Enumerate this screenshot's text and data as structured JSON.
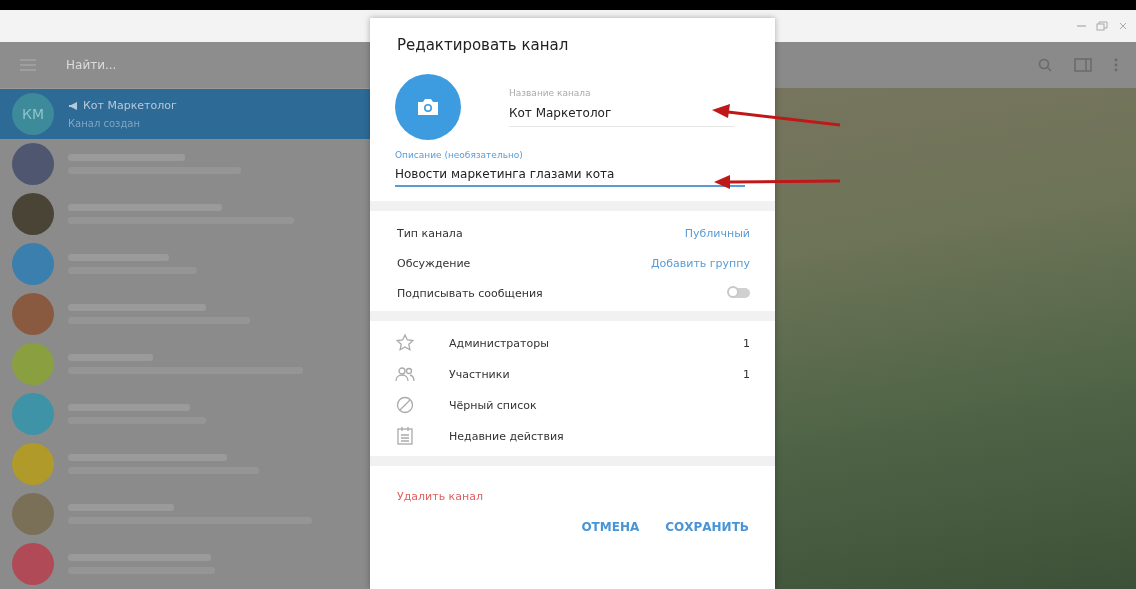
{
  "sidebar": {
    "search": {
      "placeholder": "Найти..."
    },
    "chats": [
      {
        "initials": "КМ",
        "name": "Кот Маркетолог",
        "status": "Канал создан",
        "selected": true,
        "color": "#3d8a9a"
      },
      {
        "selected": false,
        "color": "#4e5670"
      },
      {
        "selected": false,
        "color": "#4a4436"
      },
      {
        "selected": false,
        "color": "#3a7fae"
      },
      {
        "selected": false,
        "color": "#8a5a40"
      },
      {
        "selected": false,
        "color": "#8aa040"
      },
      {
        "selected": false,
        "color": "#3f93a6"
      },
      {
        "selected": false,
        "color": "#b09a2a"
      },
      {
        "selected": false,
        "color": "#7a7058"
      },
      {
        "selected": false,
        "color": "#b04a56"
      }
    ]
  },
  "dialog": {
    "title": "Редактировать канал",
    "name_field": {
      "label": "Название канала",
      "value": "Кот Маркетолог"
    },
    "description_field": {
      "label": "Описание (необязательно)",
      "value": "Новости маркетинга глазами кота"
    },
    "settings": [
      {
        "kind": "link",
        "label": "Тип канала",
        "value": "Публичный"
      },
      {
        "kind": "link",
        "label": "Обсуждение",
        "value": "Добавить группу"
      },
      {
        "kind": "toggle",
        "label": "Подписывать сообщения",
        "on": false
      }
    ],
    "items": [
      {
        "label": "Администраторы",
        "count": "1"
      },
      {
        "label": "Участники",
        "count": "1"
      },
      {
        "label": "Чёрный список"
      },
      {
        "label": "Недавние действия"
      }
    ],
    "delete_label": "Удалить канал",
    "buttons": [
      "ОТМЕНА",
      "СОХРАНИТЬ"
    ]
  }
}
